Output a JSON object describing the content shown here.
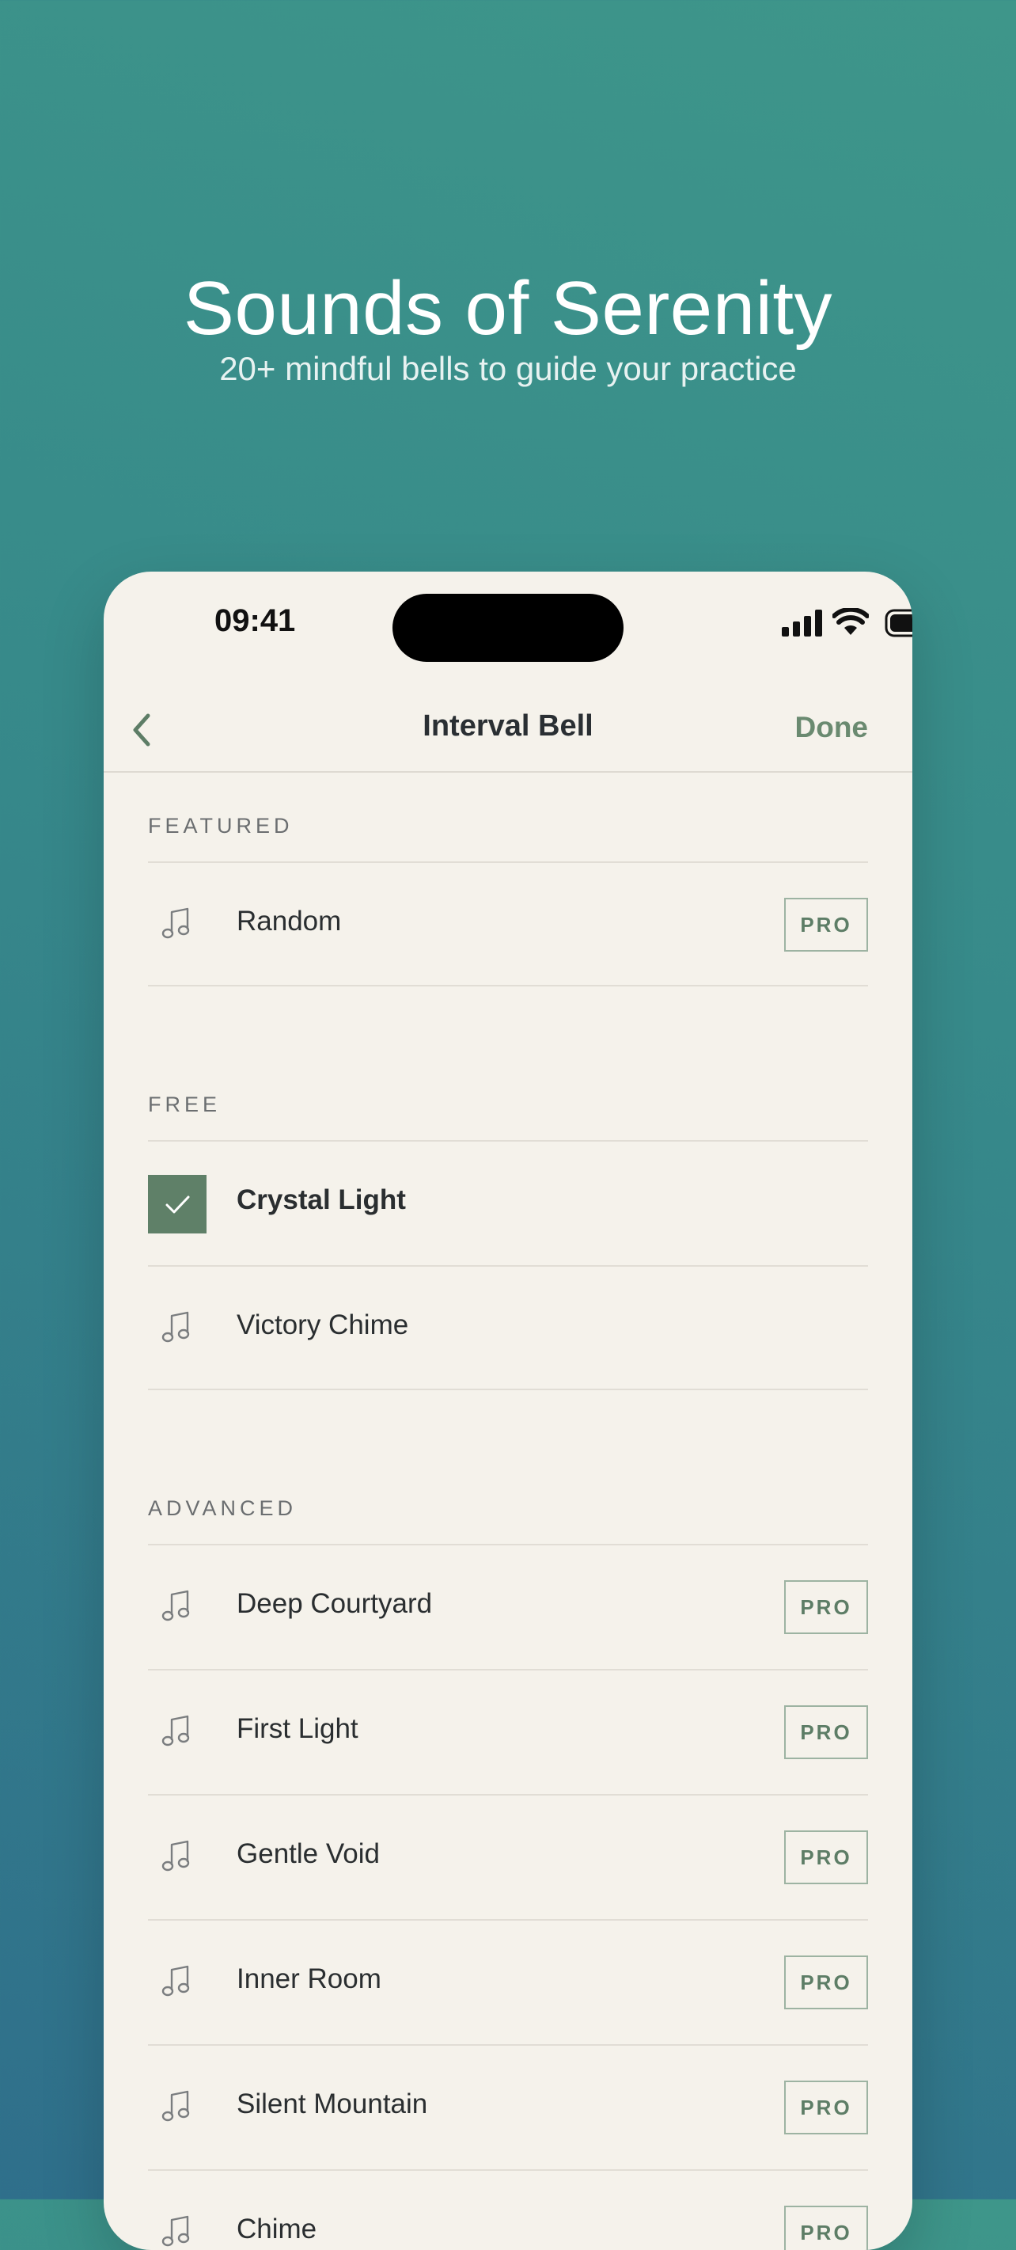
{
  "hero": {
    "title": "Sounds of Serenity",
    "subtitle": "20+ mindful bells to guide your practice"
  },
  "status_bar": {
    "time": "09:41",
    "icons": [
      "cellular-signal-icon",
      "wifi-icon",
      "battery-icon"
    ]
  },
  "nav": {
    "back_icon": "chevron-left-icon",
    "title": "Interval Bell",
    "done_label": "Done"
  },
  "badge_label": "PRO",
  "colors": {
    "accent": "#5f8068",
    "background": "#f5f2eb",
    "gradient_top": "#3e968a",
    "gradient_bottom": "#2f6f8b"
  },
  "sections": [
    {
      "title": "FEATURED",
      "items": [
        {
          "label": "Random",
          "pro": true,
          "selected": false,
          "icon": "music-note-icon"
        }
      ]
    },
    {
      "title": "FREE",
      "items": [
        {
          "label": "Crystal Light",
          "pro": false,
          "selected": true,
          "icon": "checkmark-icon"
        },
        {
          "label": "Victory Chime",
          "pro": false,
          "selected": false,
          "icon": "music-note-icon"
        }
      ]
    },
    {
      "title": "ADVANCED",
      "items": [
        {
          "label": "Deep Courtyard",
          "pro": true,
          "selected": false,
          "icon": "music-note-icon"
        },
        {
          "label": "First Light",
          "pro": true,
          "selected": false,
          "icon": "music-note-icon"
        },
        {
          "label": "Gentle Void",
          "pro": true,
          "selected": false,
          "icon": "music-note-icon"
        },
        {
          "label": "Inner Room",
          "pro": true,
          "selected": false,
          "icon": "music-note-icon"
        },
        {
          "label": "Silent Mountain",
          "pro": true,
          "selected": false,
          "icon": "music-note-icon"
        },
        {
          "label": "Chime",
          "pro": true,
          "selected": false,
          "icon": "music-note-icon"
        }
      ]
    }
  ]
}
